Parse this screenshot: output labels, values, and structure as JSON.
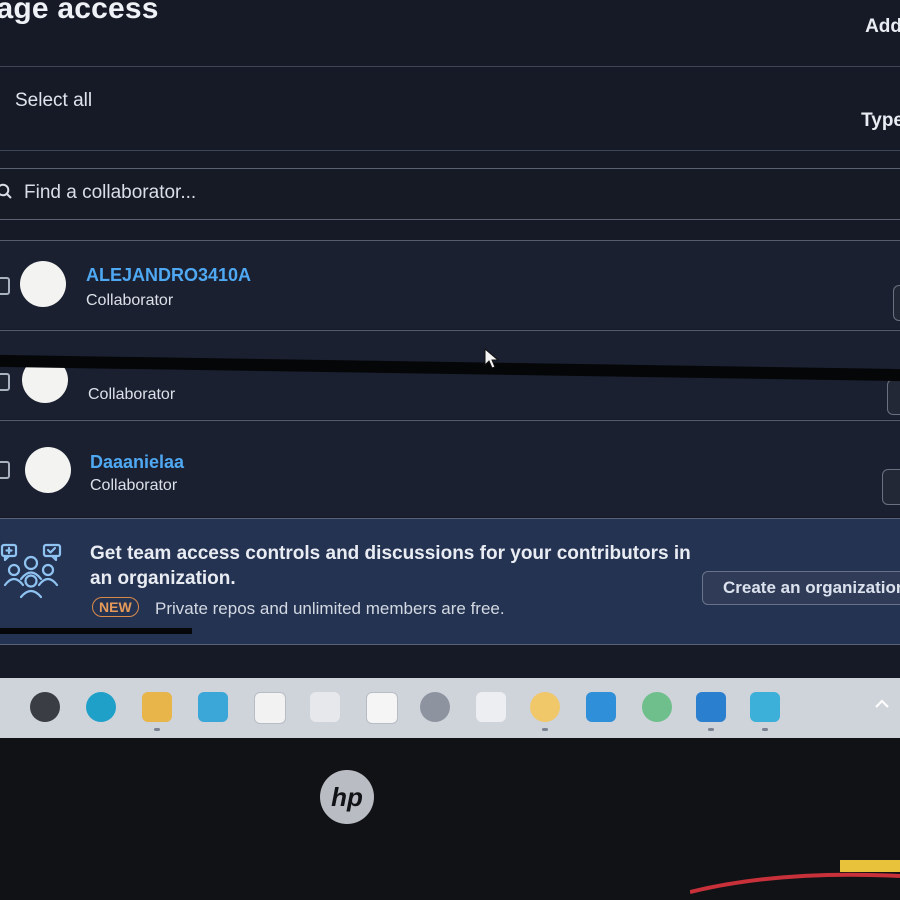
{
  "header": {
    "title": "nage access",
    "add_label": "Add",
    "select_all_label": "Select all",
    "type_label": "Type"
  },
  "search": {
    "placeholder": "Find a collaborator..."
  },
  "collaborators": [
    {
      "username": "ALEJANDRO3410A",
      "role": "Collaborator"
    },
    {
      "username": "",
      "role": "Collaborator"
    },
    {
      "username": "Daaanielaa",
      "role": "Collaborator"
    }
  ],
  "promo": {
    "heading": "Get team access controls and discussions for your contributors in an organization.",
    "badge": "NEW",
    "subtext": "Private repos and unlimited members are free.",
    "button_label": "Create an organization"
  },
  "taskbar": {
    "icons": [
      "power-icon",
      "edge-icon",
      "file-explorer-icon",
      "photos-icon",
      "files-icon",
      "pen-icon",
      "roblox-icon",
      "game-icon",
      "chat-icon",
      "lamp-icon",
      "store-icon",
      "whatsapp-icon",
      "vscode-icon",
      "phone-link-icon"
    ]
  },
  "monitor": {
    "brand": "hp"
  },
  "colors": {
    "accent_link": "#4fa8f2",
    "badge": "#e59a5a",
    "promo_background": "#253352",
    "screen_background": "#161a26"
  }
}
